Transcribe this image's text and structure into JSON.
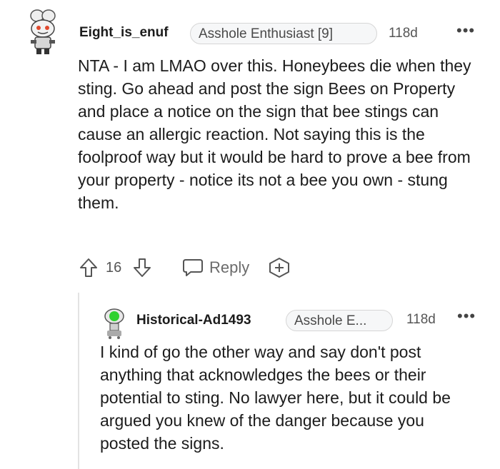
{
  "comments": [
    {
      "username": "Eight_is_enuf",
      "flair": "Asshole Enthusiast [9]",
      "age": "118d",
      "text": "NTA - I am LMAO over this. Honeybees die when they sting. Go ahead and post the sign Bees on Property and place a notice on the sign that bee stings can cause an allergic reaction. Not saying this is the foolproof way but it would be hard to prove a bee from your property - notice its not a bee you own - stung them.",
      "votes": "16",
      "reply_label": "Reply"
    },
    {
      "username": "Historical-Ad1493",
      "flair": "Asshole E...",
      "age": "118d",
      "text": "I kind of go the other way and say don't post anything that acknowledges the bees or their potential to sting. No lawyer here, but it could be argued you knew of the danger because you posted the signs."
    }
  ],
  "colors": {
    "text": "#1c1c1c",
    "muted": "#555555",
    "flair_bg": "#f6f7f8",
    "thread_line": "#e3e3e3"
  },
  "icons": [
    "snoo-avatar",
    "upvote-arrow",
    "downvote-arrow",
    "reply-bubble",
    "award-plus",
    "more-dots"
  ]
}
